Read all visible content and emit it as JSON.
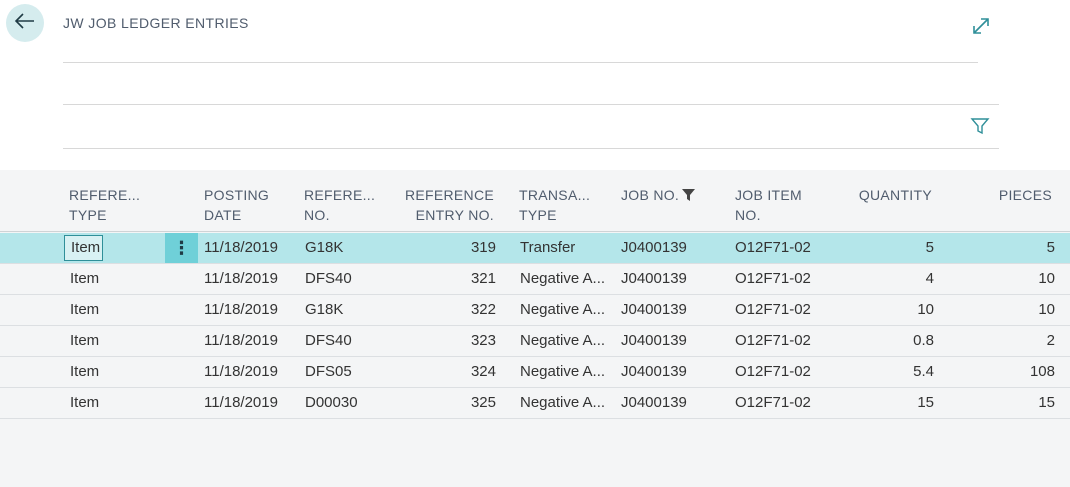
{
  "page": {
    "title": "JW JOB LEDGER ENTRIES"
  },
  "columns": [
    {
      "line1": "REFERE...",
      "line2": "TYPE"
    },
    {
      "line1": "POSTING",
      "line2": "DATE"
    },
    {
      "line1": "REFERE...",
      "line2": "NO."
    },
    {
      "line1": "REFERENCE",
      "line2": "ENTRY NO."
    },
    {
      "line1": "TRANSA...",
      "line2": "TYPE"
    },
    {
      "line1": "",
      "line2": "JOB NO."
    },
    {
      "line1": "JOB ITEM",
      "line2": "NO."
    },
    {
      "line1": "",
      "line2": "QUANTITY"
    },
    {
      "line1": "",
      "line2": "PIECES"
    }
  ],
  "rows": [
    {
      "ref_type": "Item",
      "posting_date": "11/18/2019",
      "ref_no": "G18K",
      "entry_no": "319",
      "trans_type": "Transfer",
      "job_no": "J0400139",
      "job_item_no": "O12F71-02",
      "quantity": "5",
      "pieces": "5"
    },
    {
      "ref_type": "Item",
      "posting_date": "11/18/2019",
      "ref_no": "DFS40",
      "entry_no": "321",
      "trans_type": "Negative A...",
      "job_no": "J0400139",
      "job_item_no": "O12F71-02",
      "quantity": "4",
      "pieces": "10"
    },
    {
      "ref_type": "Item",
      "posting_date": "11/18/2019",
      "ref_no": "G18K",
      "entry_no": "322",
      "trans_type": "Negative A...",
      "job_no": "J0400139",
      "job_item_no": "O12F71-02",
      "quantity": "10",
      "pieces": "10"
    },
    {
      "ref_type": "Item",
      "posting_date": "11/18/2019",
      "ref_no": "DFS40",
      "entry_no": "323",
      "trans_type": "Negative A...",
      "job_no": "J0400139",
      "job_item_no": "O12F71-02",
      "quantity": "0.8",
      "pieces": "2"
    },
    {
      "ref_type": "Item",
      "posting_date": "11/18/2019",
      "ref_no": "DFS05",
      "entry_no": "324",
      "trans_type": "Negative A...",
      "job_no": "J0400139",
      "job_item_no": "O12F71-02",
      "quantity": "5.4",
      "pieces": "108"
    },
    {
      "ref_type": "Item",
      "posting_date": "11/18/2019",
      "ref_no": "D00030",
      "entry_no": "325",
      "trans_type": "Negative A...",
      "job_no": "J0400139",
      "job_item_no": "O12F71-02",
      "quantity": "15",
      "pieces": "15"
    }
  ],
  "row_actions_glyph": "⋮",
  "icons": {
    "back": "arrow-left-icon",
    "expand": "expand-icon",
    "filter": "filter-icon",
    "column_filter": "filter-funnel-icon"
  },
  "colors": {
    "accent": "#2f8f99",
    "selected_row": "#b4e6ea",
    "back_circle": "#d5ecee"
  }
}
